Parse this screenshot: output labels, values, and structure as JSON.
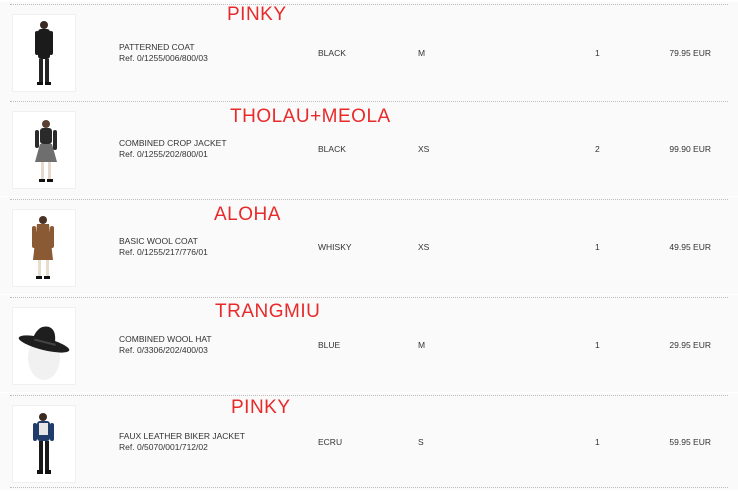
{
  "order": {
    "rows": [
      {
        "annotation": "PINKY",
        "name": "PATTERNED COAT",
        "ref": "Ref. 0/1255/006/800/03",
        "colour": "BLACK",
        "size": "M",
        "qty": "1",
        "price": "79.95 EUR",
        "thumb_icon": "black-coat-model-image"
      },
      {
        "annotation": "THOLAU+MEOLA",
        "name": "COMBINED CROP JACKET",
        "ref": "Ref. 0/1255/202/800/01",
        "colour": "BLACK",
        "size": "XS",
        "qty": "2",
        "price": "99.90 EUR",
        "thumb_icon": "crop-jacket-model-image"
      },
      {
        "annotation": "ALOHA",
        "name": "BASIC WOOL COAT",
        "ref": "Ref. 0/1255/217/776/01",
        "colour": "WHISKY",
        "size": "XS",
        "qty": "1",
        "price": "49.95 EUR",
        "thumb_icon": "wool-coat-model-image"
      },
      {
        "annotation": "TRANGMIU",
        "name": "COMBINED WOOL HAT",
        "ref": "Ref. 0/3306/202/400/03",
        "colour": "BLUE",
        "size": "M",
        "qty": "1",
        "price": "29.95 EUR",
        "thumb_icon": "wool-hat-image"
      },
      {
        "annotation": "PINKY",
        "name": "FAUX LEATHER BIKER JACKET",
        "ref": "Ref. 0/5070/001/712/02",
        "colour": "ECRU",
        "size": "S",
        "qty": "1",
        "price": "59.95 EUR",
        "thumb_icon": "biker-jacket-model-image"
      }
    ]
  },
  "colors": {
    "annotation": "#e82a2a",
    "row_background": "#fafafa",
    "divider": "#bdbdbd"
  }
}
